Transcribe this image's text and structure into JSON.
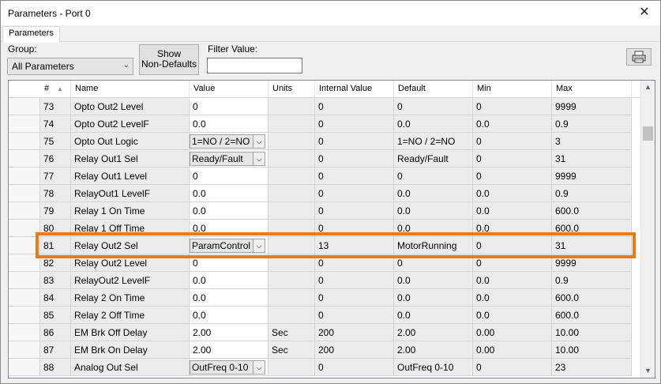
{
  "window": {
    "title": "Parameters -  Port 0"
  },
  "tabs": [
    {
      "label": "Parameters"
    }
  ],
  "toolbar": {
    "group_label": "Group:",
    "group_value": "All Parameters",
    "show_button_line1": "Show",
    "show_button_line2": "Non-Defaults",
    "filter_label": "Filter Value:",
    "filter_value": ""
  },
  "columns": {
    "num": "#",
    "name": "Name",
    "value": "Value",
    "units": "Units",
    "internal": "Internal Value",
    "default": "Default",
    "min": "Min",
    "max": "Max"
  },
  "rows": [
    {
      "num": "73",
      "name": "Opto Out2 Level",
      "value": "0",
      "dropdown": false,
      "units": "",
      "internal": "0",
      "default": "0",
      "min": "0",
      "max": "9999"
    },
    {
      "num": "74",
      "name": "Opto Out2 LevelF",
      "value": "0.0",
      "dropdown": false,
      "units": "",
      "internal": "0",
      "default": "0.0",
      "min": "0.0",
      "max": "0.9"
    },
    {
      "num": "75",
      "name": "Opto Out Logic",
      "value": "1=NO / 2=NO",
      "dropdown": true,
      "units": "",
      "internal": "0",
      "default": "1=NO / 2=NO",
      "min": "0",
      "max": "3"
    },
    {
      "num": "76",
      "name": "Relay Out1 Sel",
      "value": "Ready/Fault",
      "dropdown": true,
      "units": "",
      "internal": "0",
      "default": "Ready/Fault",
      "min": "0",
      "max": "31"
    },
    {
      "num": "77",
      "name": "Relay Out1 Level",
      "value": "0",
      "dropdown": false,
      "units": "",
      "internal": "0",
      "default": "0",
      "min": "0",
      "max": "9999"
    },
    {
      "num": "78",
      "name": "RelayOut1 LevelF",
      "value": "0.0",
      "dropdown": false,
      "units": "",
      "internal": "0",
      "default": "0.0",
      "min": "0.0",
      "max": "0.9"
    },
    {
      "num": "79",
      "name": "Relay 1 On Time",
      "value": "0.0",
      "dropdown": false,
      "units": "",
      "internal": "0",
      "default": "0.0",
      "min": "0.0",
      "max": "600.0"
    },
    {
      "num": "80",
      "name": "Relay 1 Off Time",
      "value": "0.0",
      "dropdown": false,
      "units": "",
      "internal": "0",
      "default": "0.0",
      "min": "0.0",
      "max": "600.0"
    },
    {
      "num": "81",
      "name": "Relay Out2 Sel",
      "value": "ParamControl",
      "dropdown": true,
      "units": "",
      "internal": "13",
      "default": "MotorRunning",
      "min": "0",
      "max": "31"
    },
    {
      "num": "82",
      "name": "Relay Out2 Level",
      "value": "0",
      "dropdown": false,
      "units": "",
      "internal": "0",
      "default": "0",
      "min": "0",
      "max": "9999"
    },
    {
      "num": "83",
      "name": "RelayOut2 LevelF",
      "value": "0.0",
      "dropdown": false,
      "units": "",
      "internal": "0",
      "default": "0.0",
      "min": "0.0",
      "max": "0.9"
    },
    {
      "num": "84",
      "name": "Relay 2 On Time",
      "value": "0.0",
      "dropdown": false,
      "units": "",
      "internal": "0",
      "default": "0.0",
      "min": "0.0",
      "max": "600.0"
    },
    {
      "num": "85",
      "name": "Relay 2 Off Time",
      "value": "0.0",
      "dropdown": false,
      "units": "",
      "internal": "0",
      "default": "0.0",
      "min": "0.0",
      "max": "600.0"
    },
    {
      "num": "86",
      "name": "EM Brk Off Delay",
      "value": "2.00",
      "dropdown": false,
      "units": "Sec",
      "internal": "200",
      "default": "2.00",
      "min": "0.00",
      "max": "10.00"
    },
    {
      "num": "87",
      "name": "EM Brk On Delay",
      "value": "2.00",
      "dropdown": false,
      "units": "Sec",
      "internal": "200",
      "default": "2.00",
      "min": "0.00",
      "max": "10.00"
    },
    {
      "num": "88",
      "name": "Analog Out Sel",
      "value": "OutFreq 0-10",
      "dropdown": true,
      "units": "",
      "internal": "0",
      "default": "OutFreq 0-10",
      "min": "0",
      "max": "23"
    }
  ],
  "highlighted_row": "81",
  "icons": {
    "close": "close-icon",
    "print": "printer-icon",
    "sort": "sort-up-icon"
  },
  "colors": {
    "highlight": "#f07a12"
  }
}
